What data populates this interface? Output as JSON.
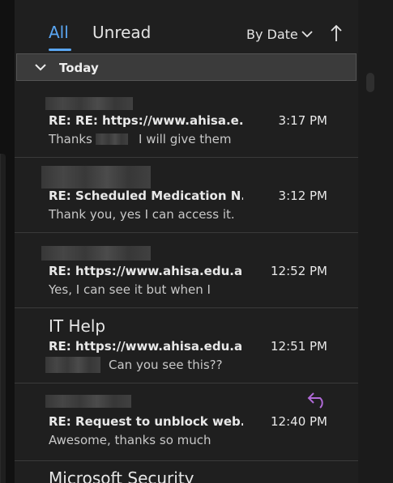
{
  "tabs": {
    "all": "All",
    "unread": "Unread"
  },
  "sort": {
    "label": "By Date"
  },
  "group": {
    "label": "Today"
  },
  "messages": [
    {
      "sender": "",
      "subject": "RE: RE: https://www.ahisa.e...",
      "time": "3:17 PM",
      "preview_a": "Thanks",
      "preview_b": "I will give them"
    },
    {
      "sender": "",
      "subject": "RE: Scheduled Medication N...",
      "time": "3:12 PM",
      "preview": "Thank you,  yes I can access it."
    },
    {
      "sender": "",
      "subject": "RE: https://www.ahisa.edu.a...",
      "time": "12:52 PM",
      "preview": "Yes, I can see it but when I"
    },
    {
      "sender": "IT Help",
      "subject": "RE: https://www.ahisa.edu.a...",
      "time": "12:51 PM",
      "preview": "Can you see this??"
    },
    {
      "sender": "",
      "subject": "RE: Request to unblock web...",
      "time": "12:40 PM",
      "preview": "Awesome, thanks so much",
      "icon": "reply-icon"
    },
    {
      "sender": "Microsoft Security"
    }
  ],
  "colors": {
    "accent": "#5aa6f2",
    "reply": "#b16ad8"
  }
}
